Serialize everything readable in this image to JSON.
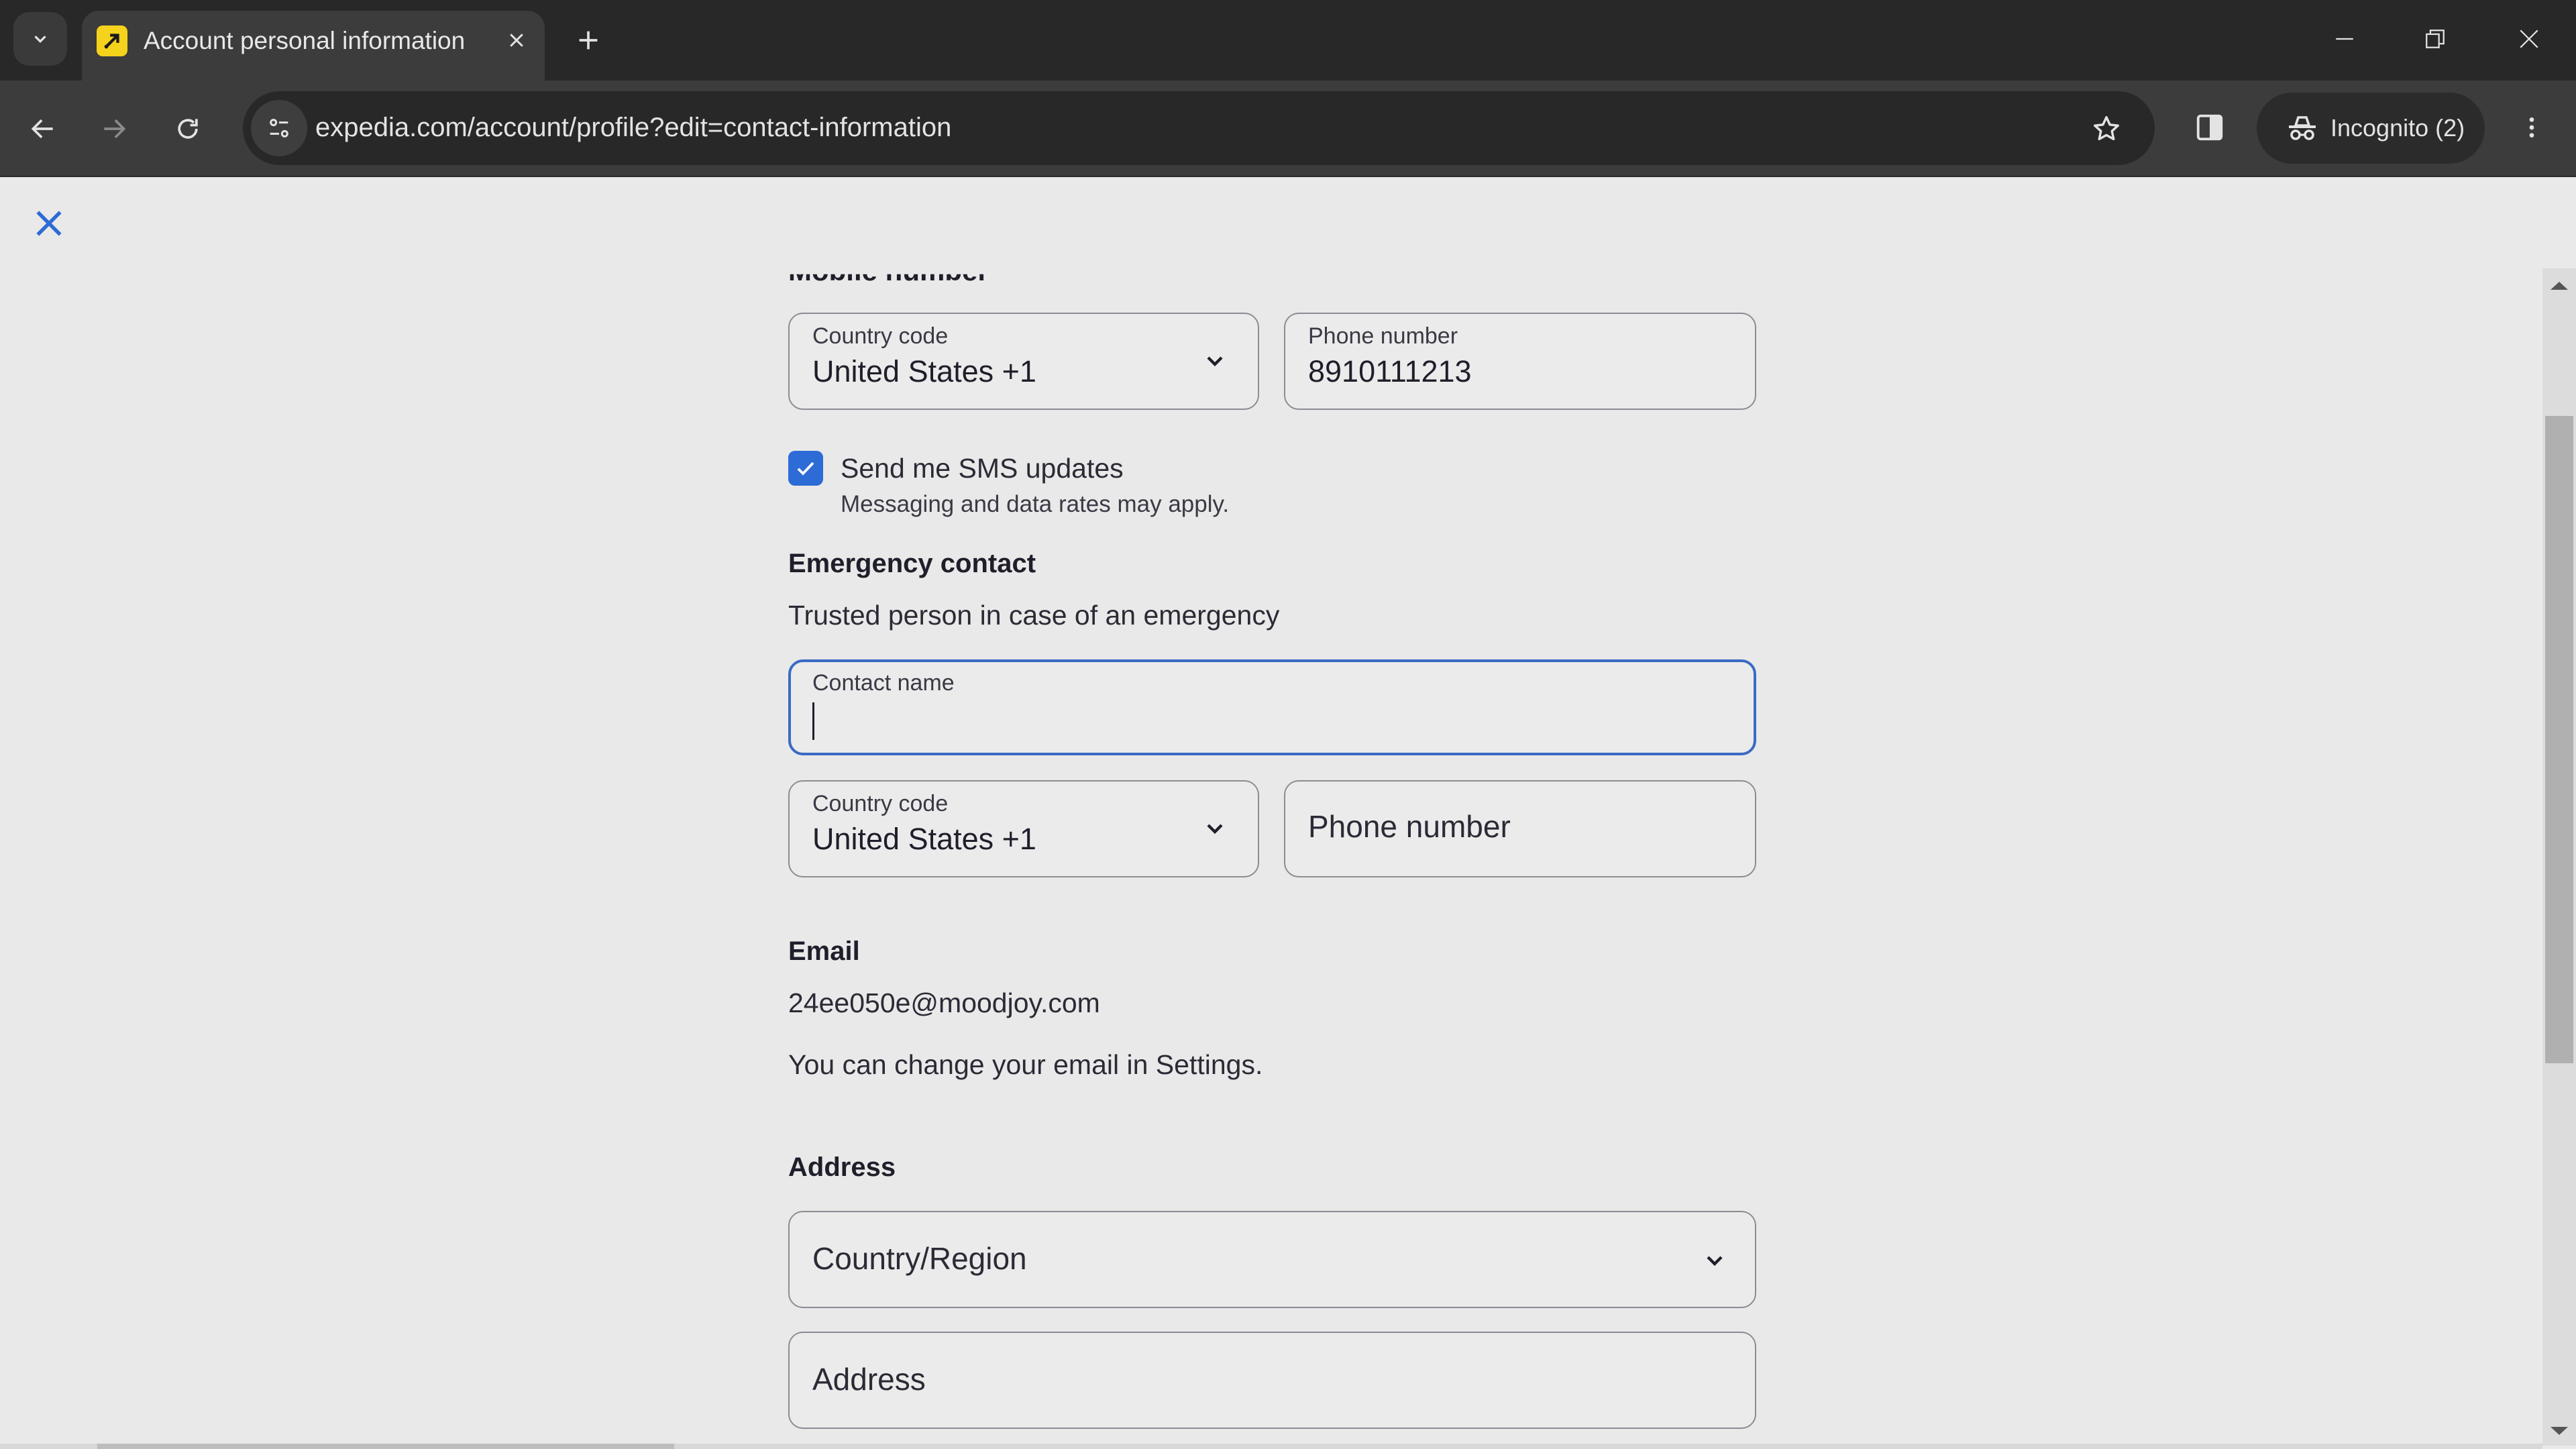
{
  "browser": {
    "tab": {
      "title": "Account personal information",
      "favicon": "expedia-logo-icon"
    },
    "url": "expedia.com/account/profile?edit=contact-information",
    "incognito_label": "Incognito (2)",
    "icons": {
      "tab_list": "chevron-down-icon",
      "tab_close": "close-icon",
      "new_tab": "plus-icon",
      "back": "arrow-left-icon",
      "forward": "arrow-right-icon",
      "reload": "reload-icon",
      "site_info": "tune-icon",
      "bookmark": "star-icon",
      "side_panel": "side-panel-icon",
      "incognito": "incognito-icon",
      "menu": "kebab-menu-icon",
      "minimize": "minimize-icon",
      "restore": "restore-icon",
      "close_window": "close-icon"
    }
  },
  "page": {
    "close_icon": "close-icon",
    "accent_color": "#2d6bd6",
    "mobile": {
      "section_title": "Mobile number",
      "country_code": {
        "label": "Country code",
        "value": "United States +1"
      },
      "phone": {
        "label": "Phone number",
        "value": "8910111213"
      },
      "sms": {
        "label": "Send me SMS updates",
        "checked": true,
        "note": "Messaging and data rates may apply."
      }
    },
    "emergency": {
      "section_title": "Emergency contact",
      "description": "Trusted person in case of an emergency",
      "contact_name": {
        "label": "Contact name",
        "value": ""
      },
      "country_code": {
        "label": "Country code",
        "value": "United States +1"
      },
      "phone": {
        "placeholder": "Phone number",
        "value": ""
      }
    },
    "email": {
      "section_title": "Email",
      "value": "24ee050e@moodjoy.com",
      "note": "You can change your email in Settings."
    },
    "address": {
      "section_title": "Address",
      "country_region": {
        "placeholder": "Country/Region"
      },
      "address_line": {
        "placeholder": "Address"
      }
    }
  }
}
